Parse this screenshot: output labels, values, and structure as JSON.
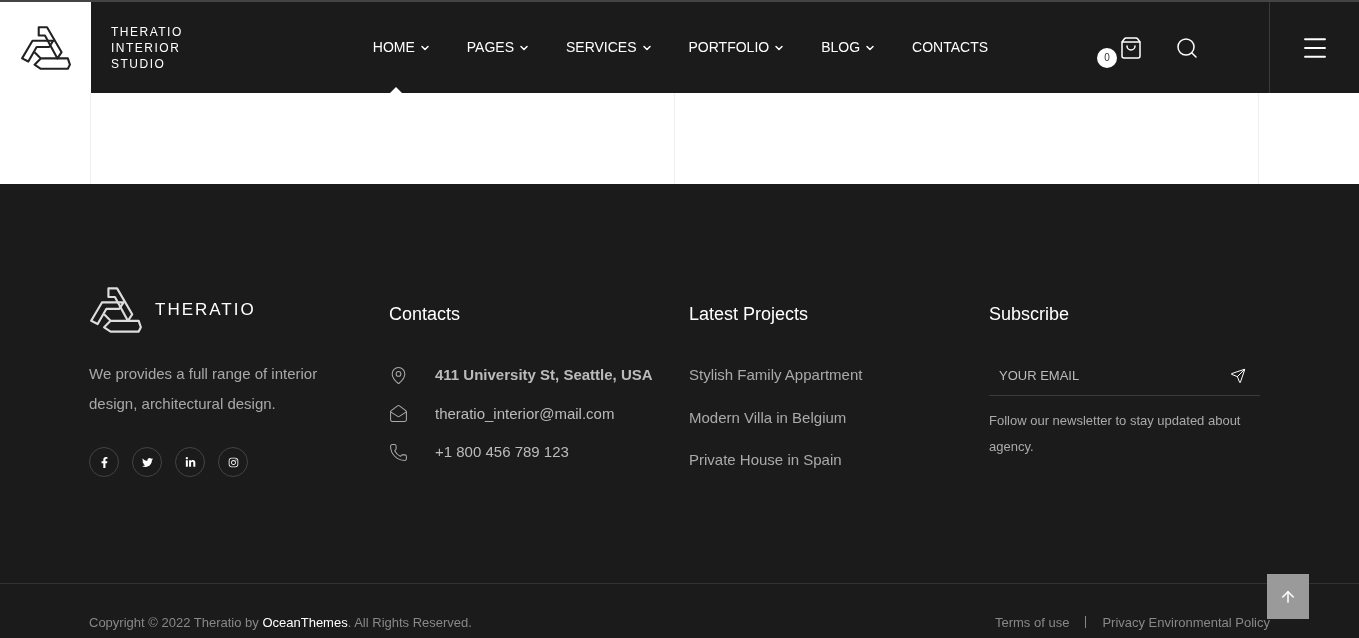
{
  "header": {
    "brand_lines": [
      "THERATIO",
      "INTERIOR",
      "STUDIO"
    ],
    "nav": [
      {
        "label": "HOME",
        "has_dropdown": true,
        "selected": true
      },
      {
        "label": "PAGES",
        "has_dropdown": true,
        "selected": false
      },
      {
        "label": "SERVICES",
        "has_dropdown": true,
        "selected": false
      },
      {
        "label": "PORTFOLIO",
        "has_dropdown": true,
        "selected": false
      },
      {
        "label": "BLOG",
        "has_dropdown": true,
        "selected": false
      },
      {
        "label": "CONTACTS",
        "has_dropdown": false,
        "selected": false
      }
    ],
    "cart_count": "0"
  },
  "footer": {
    "brand": "THERATIO",
    "about": "We provides a full range of interior design, architectural design.",
    "socials": [
      {
        "kind": "facebook"
      },
      {
        "kind": "twitter"
      },
      {
        "kind": "linkedin"
      },
      {
        "kind": "instagram"
      }
    ],
    "contacts": {
      "title": "Contacts",
      "items": [
        {
          "kind": "address",
          "text": "411 University St, Seattle, USA"
        },
        {
          "kind": "email",
          "text": "theratio_interior@mail.com"
        },
        {
          "kind": "phone",
          "text": "+1 800 456 789 123"
        }
      ]
    },
    "projects": {
      "title": "Latest Projects",
      "items": [
        "Stylish Family Appartment",
        "Modern Villa in Belgium",
        "Private House in Spain"
      ]
    },
    "subscribe": {
      "title": "Subscribe",
      "placeholder": "YOUR EMAIL",
      "note": "Follow our newsletter to stay updated about agency."
    },
    "copyright": {
      "before": "Copyright © 2022 Theratio by",
      "link": "OceanThemes",
      "after": ". All Rights Reserved."
    },
    "links": [
      "Terms of use",
      "Privacy Environmental Policy"
    ]
  }
}
